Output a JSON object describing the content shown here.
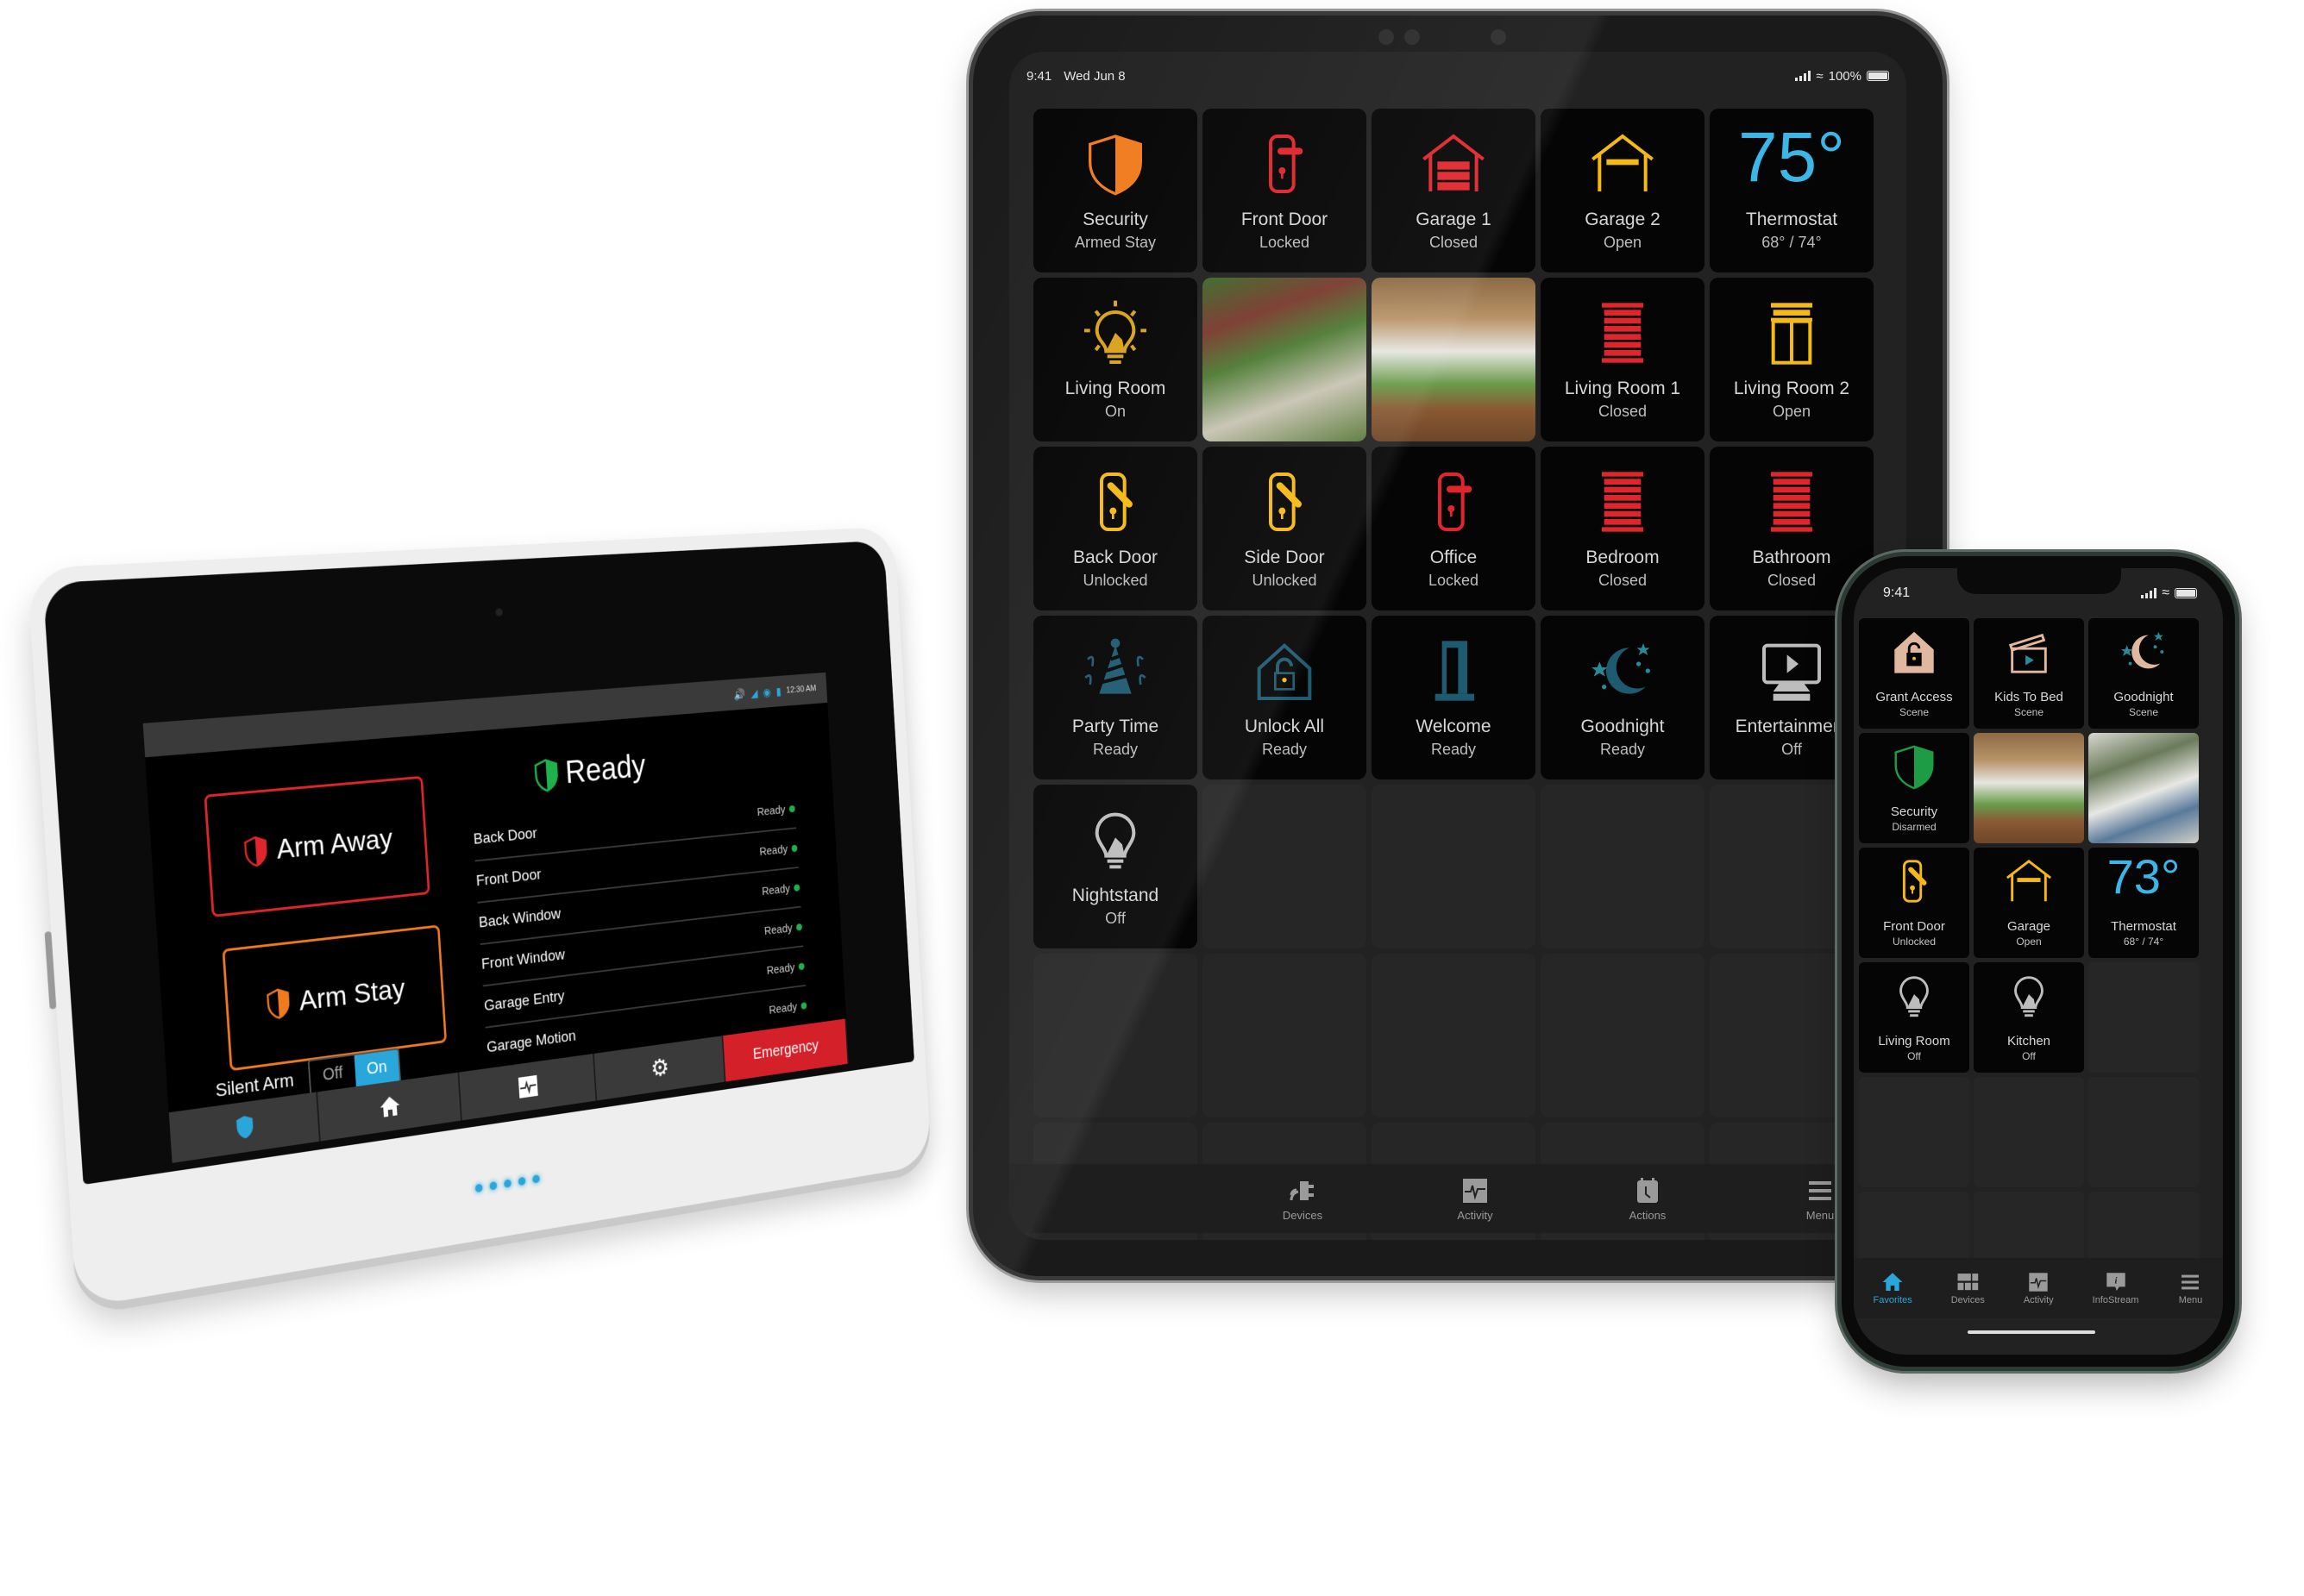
{
  "ipad": {
    "status": {
      "time": "9:41",
      "date": "Wed Jun 8",
      "battery": "100%"
    },
    "tiles": [
      {
        "name": "Security",
        "state": "Armed Stay",
        "icon": "shield-half-icon",
        "color": "#f07b1e"
      },
      {
        "name": "Front Door",
        "state": "Locked",
        "icon": "door-lock-icon",
        "color": "#e0262c"
      },
      {
        "name": "Garage 1",
        "state": "Closed",
        "icon": "garage-closed-icon",
        "color": "#e0262c"
      },
      {
        "name": "Garage 2",
        "state": "Open",
        "icon": "garage-open-icon",
        "color": "#f5b914"
      },
      {
        "name": "Thermostat",
        "state": "68° / 74°",
        "temp": "75°",
        "icon": "thermostat-icon",
        "color": "#3bb6e6"
      },
      {
        "name": "Living Room",
        "state": "On",
        "icon": "light-bulb-on-icon",
        "color": "#d9a21b"
      },
      {
        "type": "camera",
        "icon": "camera-feed-garden"
      },
      {
        "type": "camera",
        "icon": "camera-feed-patio"
      },
      {
        "name": "Living Room 1",
        "state": "Closed",
        "icon": "blinds-closed-icon",
        "color": "#e0262c"
      },
      {
        "name": "Living Room 2",
        "state": "Open",
        "icon": "blinds-open-icon",
        "color": "#f5b914"
      },
      {
        "name": "Back Door",
        "state": "Unlocked",
        "icon": "door-unlocked-icon",
        "color": "#f5b914"
      },
      {
        "name": "Side Door",
        "state": "Unlocked",
        "icon": "door-unlocked-icon",
        "color": "#f5b914"
      },
      {
        "name": "Office",
        "state": "Locked",
        "icon": "door-lock-icon",
        "color": "#e0262c"
      },
      {
        "name": "Bedroom",
        "state": "Closed",
        "icon": "blinds-closed-icon",
        "color": "#e0262c"
      },
      {
        "name": "Bathroom",
        "state": "Closed",
        "icon": "blinds-closed-icon",
        "color": "#e0262c"
      },
      {
        "name": "Party Time",
        "state": "Ready",
        "icon": "party-icon",
        "color": "#1e5a70"
      },
      {
        "name": "Unlock All",
        "state": "Ready",
        "icon": "house-unlock-icon",
        "color": "#1e5a70"
      },
      {
        "name": "Welcome",
        "state": "Ready",
        "icon": "door-open-icon",
        "color": "#1e5a70"
      },
      {
        "name": "Goodnight",
        "state": "Ready",
        "icon": "moon-stars-icon",
        "color": "#1e5a70"
      },
      {
        "name": "Entertainment",
        "state": "Off",
        "icon": "tv-icon",
        "color": "#bdbdbd"
      },
      {
        "name": "Nightstand",
        "state": "Off",
        "icon": "light-bulb-off-icon",
        "color": "#bdbdbd"
      }
    ],
    "nav": [
      {
        "label": "Devices",
        "icon": "devices-plug-icon"
      },
      {
        "label": "Activity",
        "icon": "activity-pulse-icon"
      },
      {
        "label": "Actions",
        "icon": "calendar-clock-icon"
      },
      {
        "label": "Menu",
        "icon": "hamburger-menu-icon"
      }
    ]
  },
  "phone": {
    "status": {
      "time": "9:41"
    },
    "tiles": [
      {
        "name": "Grant Access",
        "state": "Scene",
        "icon": "house-unlock-icon",
        "color": "#e0b8a0"
      },
      {
        "name": "Kids To Bed",
        "state": "Scene",
        "icon": "clapperboard-icon",
        "color": "#e0b8a0"
      },
      {
        "name": "Goodnight",
        "state": "Scene",
        "icon": "moon-stars-icon",
        "color": "#e0b8a0"
      },
      {
        "name": "Security",
        "state": "Disarmed",
        "icon": "shield-half-icon",
        "color": "#1e9b45"
      },
      {
        "type": "camera",
        "icon": "camera-feed-patio"
      },
      {
        "type": "camera",
        "icon": "camera-feed-porch"
      },
      {
        "name": "Front Door",
        "state": "Unlocked",
        "icon": "door-unlocked-icon",
        "color": "#f5b914"
      },
      {
        "name": "Garage",
        "state": "Open",
        "icon": "garage-open-icon",
        "color": "#f5b914"
      },
      {
        "name": "Thermostat",
        "state": "68° / 74°",
        "temp": "73°",
        "icon": "thermostat-icon",
        "color": "#3bb6e6"
      },
      {
        "name": "Living Room",
        "state": "Off",
        "icon": "light-bulb-off-icon",
        "color": "#bdbdbd"
      },
      {
        "name": "Kitchen",
        "state": "Off",
        "icon": "light-bulb-off-icon",
        "color": "#bdbdbd"
      }
    ],
    "nav": [
      {
        "label": "Favorites",
        "icon": "home-icon",
        "active": true
      },
      {
        "label": "Devices",
        "icon": "grid-icon"
      },
      {
        "label": "Activity",
        "icon": "activity-pulse-icon"
      },
      {
        "label": "InfoStream",
        "icon": "info-bubble-icon"
      },
      {
        "label": "Menu",
        "icon": "hamburger-menu-icon"
      }
    ]
  },
  "panel": {
    "status_time": "12:30 AM",
    "arm_away": "Arm Away",
    "arm_stay": "Arm Stay",
    "ready_title": "Ready",
    "zones": [
      {
        "name": "Back Door",
        "state": "Ready"
      },
      {
        "name": "Front Door",
        "state": "Ready"
      },
      {
        "name": "Back Window",
        "state": "Ready"
      },
      {
        "name": "Front Window",
        "state": "Ready"
      },
      {
        "name": "Garage Entry",
        "state": "Ready"
      },
      {
        "name": "Garage Motion",
        "state": "Ready"
      }
    ],
    "silent_arm_label": "Silent Arm",
    "toggle_off": "Off",
    "toggle_on": "On",
    "silent_arm_value": "On",
    "nav": [
      {
        "icon": "shield-icon"
      },
      {
        "icon": "home-icon"
      },
      {
        "icon": "activity-pulse-icon"
      },
      {
        "icon": "gear-icon"
      },
      {
        "label": "Emergency",
        "icon": "emergency-button"
      }
    ],
    "colors": {
      "away": "#e0262c",
      "stay": "#f07b1e",
      "accent": "#2aa7da",
      "emergency": "#d42129",
      "ready": "#1fb14b"
    }
  }
}
